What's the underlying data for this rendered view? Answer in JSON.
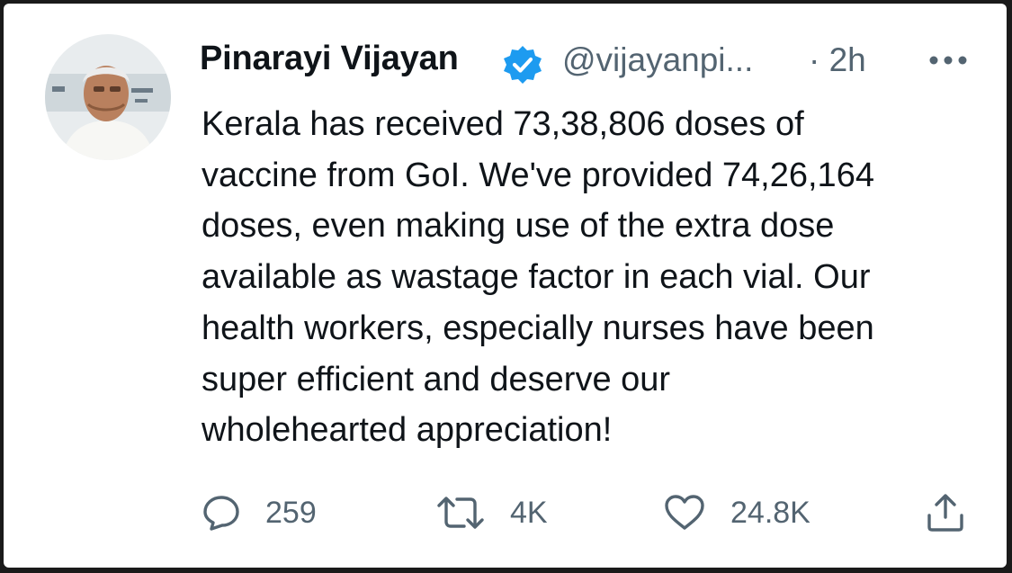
{
  "tweet": {
    "author_name": "Pinarayi Vijayan",
    "handle": "@vijayanpi...",
    "time": "· 2h",
    "verified": true,
    "text_lines": [
      "Kerala has received 73,38,806 doses of",
      "vaccine from GoI. We've provided 74,26,164",
      "doses, even making use of the extra dose",
      "available as wastage factor in each vial. Our",
      "health workers, especially nurses have been",
      "super efficient and deserve our",
      "wholehearted appreciation!"
    ],
    "actions": {
      "replies": "259",
      "retweets": "4K",
      "likes": "24.8K"
    }
  },
  "colors": {
    "text_primary": "#0f1419",
    "text_secondary": "#536471",
    "verified_badge": "#1d9bf0"
  },
  "icons": {
    "more": "more-horizontal-icon",
    "reply": "reply-bubble-icon",
    "retweet": "retweet-icon",
    "like": "heart-icon",
    "share": "share-upload-icon",
    "verified": "verified-badge-icon"
  }
}
